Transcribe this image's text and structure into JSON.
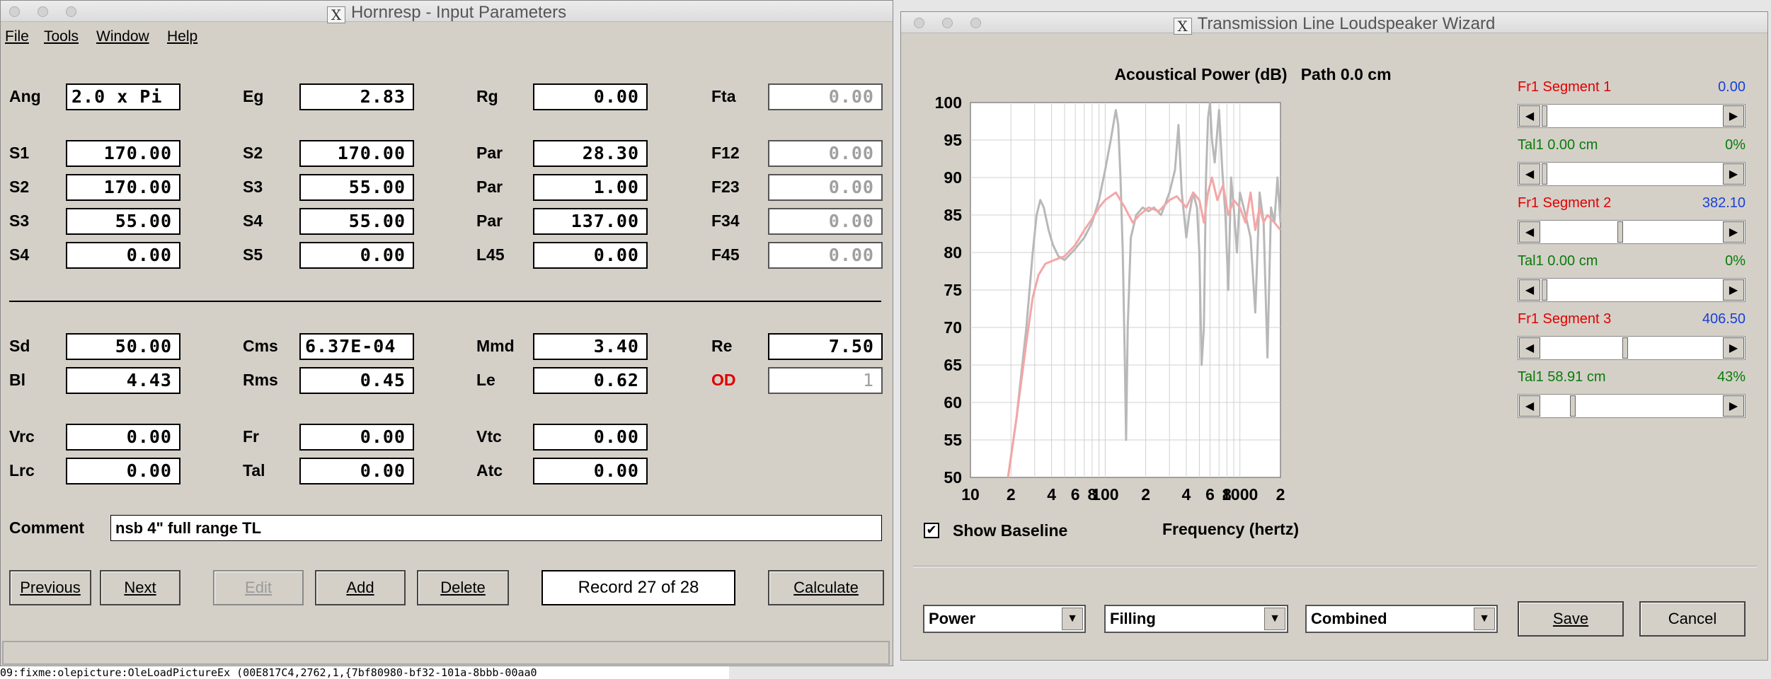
{
  "left_window": {
    "title": "Hornresp - Input Parameters",
    "menu": [
      "File",
      "Tools",
      "Window",
      "Help"
    ],
    "params_row1": [
      {
        "label": "Ang",
        "value": "2.0 x Pi"
      },
      {
        "label": "Eg",
        "value": "2.83"
      },
      {
        "label": "Rg",
        "value": "0.00"
      },
      {
        "label": "Fta",
        "value": "0.00"
      }
    ],
    "params_segments": [
      [
        {
          "label": "S1",
          "value": "170.00"
        },
        {
          "label": "S2",
          "value": "170.00"
        },
        {
          "label": "Par",
          "value": "28.30"
        },
        {
          "label": "F12",
          "value": "0.00"
        }
      ],
      [
        {
          "label": "S2",
          "value": "170.00"
        },
        {
          "label": "S3",
          "value": "55.00"
        },
        {
          "label": "Par",
          "value": "1.00"
        },
        {
          "label": "F23",
          "value": "0.00"
        }
      ],
      [
        {
          "label": "S3",
          "value": "55.00"
        },
        {
          "label": "S4",
          "value": "55.00"
        },
        {
          "label": "Par",
          "value": "137.00"
        },
        {
          "label": "F34",
          "value": "0.00"
        }
      ],
      [
        {
          "label": "S4",
          "value": "0.00"
        },
        {
          "label": "S5",
          "value": "0.00"
        },
        {
          "label": "L45",
          "value": "0.00"
        },
        {
          "label": "F45",
          "value": "0.00"
        }
      ]
    ],
    "params_driver": [
      [
        {
          "label": "Sd",
          "value": "50.00"
        },
        {
          "label": "Cms",
          "value": "6.37E-04"
        },
        {
          "label": "Mmd",
          "value": "3.40"
        },
        {
          "label": "Re",
          "value": "7.50"
        }
      ],
      [
        {
          "label": "Bl",
          "value": "4.43"
        },
        {
          "label": "Rms",
          "value": "0.45"
        },
        {
          "label": "Le",
          "value": "0.62"
        },
        {
          "label": "OD",
          "value": "1"
        }
      ]
    ],
    "params_chamber": [
      [
        {
          "label": "Vrc",
          "value": "0.00"
        },
        {
          "label": "Fr",
          "value": "0.00"
        },
        {
          "label": "Vtc",
          "value": "0.00"
        }
      ],
      [
        {
          "label": "Lrc",
          "value": "0.00"
        },
        {
          "label": "Tal",
          "value": "0.00"
        },
        {
          "label": "Atc",
          "value": "0.00"
        }
      ]
    ],
    "comment_label": "Comment",
    "comment_value": "nsb 4\" full range TL",
    "buttons": {
      "previous": "Previous",
      "next": "Next",
      "edit": "Edit",
      "add": "Add",
      "delete": "Delete",
      "calculate": "Calculate"
    },
    "record": "Record 27 of 28",
    "console_text": "09:fixme:olepicture:OleLoadPictureEx (00E817C4,2762,1,{7bf80980-bf32-101a-8bbb-00aa0"
  },
  "right_window": {
    "title": "Transmission Line Loudspeaker Wizard",
    "chart_title": "Acoustical Power (dB)   Path 0.0 cm",
    "xlabel": "Frequency (hertz)",
    "show_baseline_label": "Show Baseline",
    "show_baseline_checked": true,
    "sliders": [
      {
        "label": "Fr1  Segment 1",
        "value": "0.00",
        "label_color": "#e00000",
        "value_color": "#1a3fd6",
        "position": 0.0
      },
      {
        "label": "Tal1  0.00 cm",
        "value": "0%",
        "label_color": "#0a7a0a",
        "value_color": "#0a7a0a",
        "position": 0.0
      },
      {
        "label": "Fr1  Segment 2",
        "value": "382.10",
        "label_color": "#e00000",
        "value_color": "#1a3fd6",
        "position": 0.43
      },
      {
        "label": "Tal1  0.00 cm",
        "value": "0%",
        "label_color": "#0a7a0a",
        "value_color": "#0a7a0a",
        "position": 0.0
      },
      {
        "label": "Fr1  Segment 3",
        "value": "406.50",
        "label_color": "#e00000",
        "value_color": "#1a3fd6",
        "position": 0.46
      },
      {
        "label": "Tal1  58.91 cm",
        "value": "43%",
        "label_color": "#0a7a0a",
        "value_color": "#0a7a0a",
        "position": 0.16
      }
    ],
    "selects": [
      "Power",
      "Filling",
      "Combined"
    ],
    "buttons": {
      "save": "Save",
      "cancel": "Cancel"
    }
  },
  "chart_data": {
    "type": "line",
    "title": "Acoustical Power (dB)   Path 0.0 cm",
    "xlabel": "Frequency (hertz)",
    "ylabel": "",
    "x_scale": "log",
    "xlim": [
      10,
      2000
    ],
    "ylim": [
      50,
      100
    ],
    "yticks": [
      50,
      55,
      60,
      65,
      70,
      75,
      80,
      85,
      90,
      95,
      100
    ],
    "xtick_labels": [
      "10",
      "2",
      "4",
      "6",
      "8",
      "100",
      "2",
      "4",
      "6",
      "8",
      "1000",
      "2"
    ],
    "grid": true,
    "colors": {
      "baseline": "#b8b8b8",
      "current": "#f4a6a6"
    },
    "series": [
      {
        "points": [
          [
            19,
            50
          ],
          [
            22,
            58
          ],
          [
            26,
            70
          ],
          [
            29,
            80
          ],
          [
            31,
            85
          ],
          [
            33,
            87
          ],
          [
            35,
            86
          ],
          [
            38,
            83
          ],
          [
            41,
            81
          ],
          [
            45,
            79.5
          ],
          [
            50,
            79
          ],
          [
            60,
            80.5
          ],
          [
            70,
            82
          ],
          [
            80,
            84
          ],
          [
            90,
            87
          ],
          [
            100,
            91
          ],
          [
            110,
            95
          ],
          [
            120,
            99
          ],
          [
            125,
            97
          ],
          [
            130,
            90
          ],
          [
            135,
            80
          ],
          [
            140,
            65
          ],
          [
            143,
            55
          ],
          [
            147,
            70
          ],
          [
            155,
            82
          ],
          [
            170,
            85
          ],
          [
            190,
            86
          ],
          [
            210,
            85.5
          ],
          [
            230,
            86
          ],
          [
            260,
            85
          ],
          [
            300,
            88
          ],
          [
            330,
            91
          ],
          [
            350,
            97
          ],
          [
            370,
            88
          ],
          [
            400,
            82
          ],
          [
            420,
            85
          ],
          [
            450,
            88
          ],
          [
            480,
            86
          ],
          [
            500,
            80
          ],
          [
            520,
            65
          ],
          [
            540,
            70
          ],
          [
            560,
            90
          ],
          [
            580,
            98
          ],
          [
            600,
            100
          ],
          [
            620,
            95
          ],
          [
            650,
            92
          ],
          [
            700,
            99
          ],
          [
            740,
            91
          ],
          [
            780,
            85
          ],
          [
            820,
            75
          ],
          [
            860,
            90
          ],
          [
            900,
            86
          ],
          [
            950,
            80
          ],
          [
            1000,
            88
          ],
          [
            1100,
            85
          ],
          [
            1200,
            82
          ],
          [
            1300,
            72
          ],
          [
            1400,
            88
          ],
          [
            1500,
            84
          ],
          [
            1600,
            66
          ],
          [
            1700,
            86
          ],
          [
            1800,
            84
          ],
          [
            1900,
            90
          ],
          [
            2000,
            84
          ]
        ]
      },
      {
        "points": [
          [
            19,
            50
          ],
          [
            22,
            58
          ],
          [
            26,
            68
          ],
          [
            29,
            74
          ],
          [
            32,
            77
          ],
          [
            36,
            78.5
          ],
          [
            42,
            79
          ],
          [
            50,
            79.5
          ],
          [
            60,
            81
          ],
          [
            70,
            83
          ],
          [
            80,
            84.5
          ],
          [
            90,
            86
          ],
          [
            100,
            87
          ],
          [
            120,
            88
          ],
          [
            140,
            86
          ],
          [
            160,
            84
          ],
          [
            180,
            85
          ],
          [
            210,
            86
          ],
          [
            250,
            85.5
          ],
          [
            300,
            87
          ],
          [
            340,
            87.5
          ],
          [
            400,
            86
          ],
          [
            450,
            88
          ],
          [
            500,
            87
          ],
          [
            540,
            84
          ],
          [
            580,
            88
          ],
          [
            620,
            90
          ],
          [
            680,
            87
          ],
          [
            750,
            89
          ],
          [
            820,
            85
          ],
          [
            900,
            87
          ],
          [
            1000,
            86
          ],
          [
            1100,
            84
          ],
          [
            1200,
            88
          ],
          [
            1300,
            83
          ],
          [
            1400,
            86
          ],
          [
            1500,
            84
          ],
          [
            1600,
            85
          ],
          [
            1800,
            84
          ],
          [
            2000,
            83
          ]
        ]
      }
    ]
  }
}
